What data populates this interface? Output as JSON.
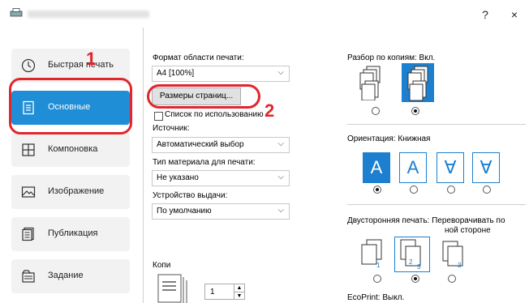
{
  "window": {
    "help": "?",
    "close": "×"
  },
  "sidebar": {
    "items": [
      {
        "label": "Быстрая печать",
        "icon": "clock-icon"
      },
      {
        "label": "Основные",
        "icon": "document-icon"
      },
      {
        "label": "Компоновка",
        "icon": "layout-icon"
      },
      {
        "label": "Изображение",
        "icon": "image-icon"
      },
      {
        "label": "Публикация",
        "icon": "publication-icon"
      },
      {
        "label": "Задание",
        "icon": "job-icon"
      }
    ]
  },
  "main": {
    "print_area_label": "Формат области печати:",
    "print_area_value": "A4  [100%]",
    "page_sizes_button": "Размеры страниц...",
    "list_in_use_label": "Список по использованию",
    "source_label": "Источник:",
    "source_value": "Автоматический выбор",
    "media_type_label": "Тип материала для печати:",
    "media_type_value": "Не указано",
    "output_label": "Устройство выдачи:",
    "output_value": "По умолчанию",
    "copies_label": "Копи",
    "copies_value": "1"
  },
  "right": {
    "collate_label": "Разбор по копиям:  Вкл.",
    "orientation_label": "Ориентация:  Книжная",
    "orientation_glyphs": [
      "A",
      "A",
      "∀",
      "∀"
    ],
    "duplex_label": "Двусторонняя печать:  Переворачивать по",
    "duplex_label2": "ной стороне",
    "ecoprint_label": "EcoPrint:  Выкл."
  },
  "callouts": {
    "one": "1",
    "two": "2"
  },
  "colors": {
    "accent": "#1f8ed6",
    "callout": "#e1262d"
  }
}
